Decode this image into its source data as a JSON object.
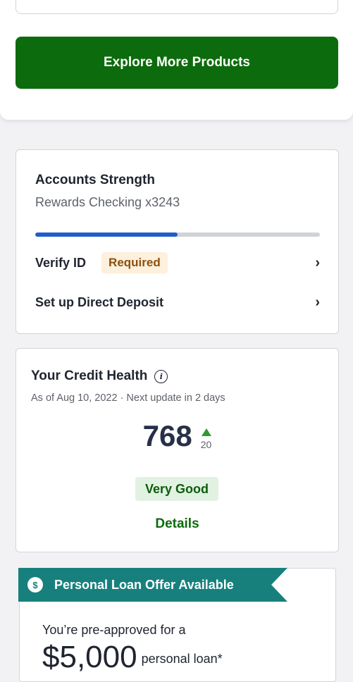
{
  "explore": {
    "label": "Explore More Products"
  },
  "accounts": {
    "title": "Accounts Strength",
    "subtitle": "Rewards Checking x3243",
    "progress_fraction": 0.5,
    "rows": [
      {
        "label": "Verify ID",
        "badge": "Required"
      },
      {
        "label": "Set up Direct Deposit"
      }
    ]
  },
  "credit": {
    "title": "Your Credit Health",
    "subtitle": "As of Aug 10, 2022  ·  Next update in 2 days",
    "score": "768",
    "delta": "20",
    "rating": "Very Good",
    "details_label": "Details"
  },
  "loan": {
    "banner": "Personal Loan Offer Available",
    "intro": "You’re pre-approved for a",
    "amount": "$5,000",
    "amount_suffix": "personal loan*"
  },
  "colors": {
    "brand_green": "#0c6b0c",
    "teal": "#17807d",
    "progress_blue": "#1f5fc8"
  }
}
